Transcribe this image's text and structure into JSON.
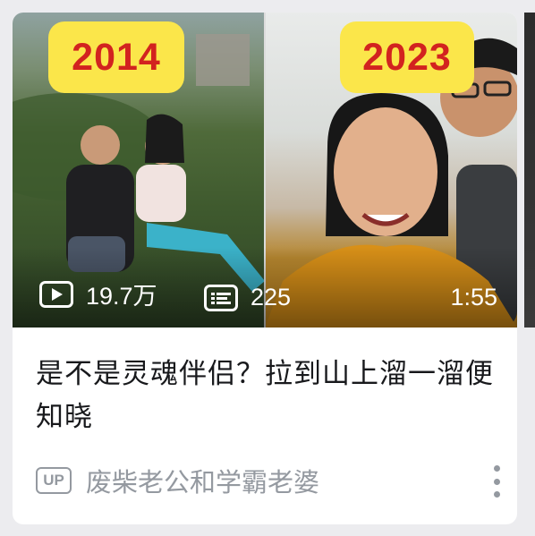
{
  "video_card": {
    "badge_left": "2014",
    "badge_right": "2023",
    "views": "19.7万",
    "danmaku": "225",
    "duration": "1:55",
    "title": "是不是灵魂伴侣？拉到山上溜一溜便知晓",
    "up_label": "UP",
    "uploader": "废柴老公和学霸老婆"
  },
  "icons": {
    "views": "play-icon",
    "danmaku": "danmaku-icon",
    "more": "more-vertical-icon"
  },
  "colors": {
    "badge_bg": "#fbe64a",
    "badge_text": "#d2231f",
    "title_text": "#18191c",
    "secondary_text": "#9499a0"
  }
}
